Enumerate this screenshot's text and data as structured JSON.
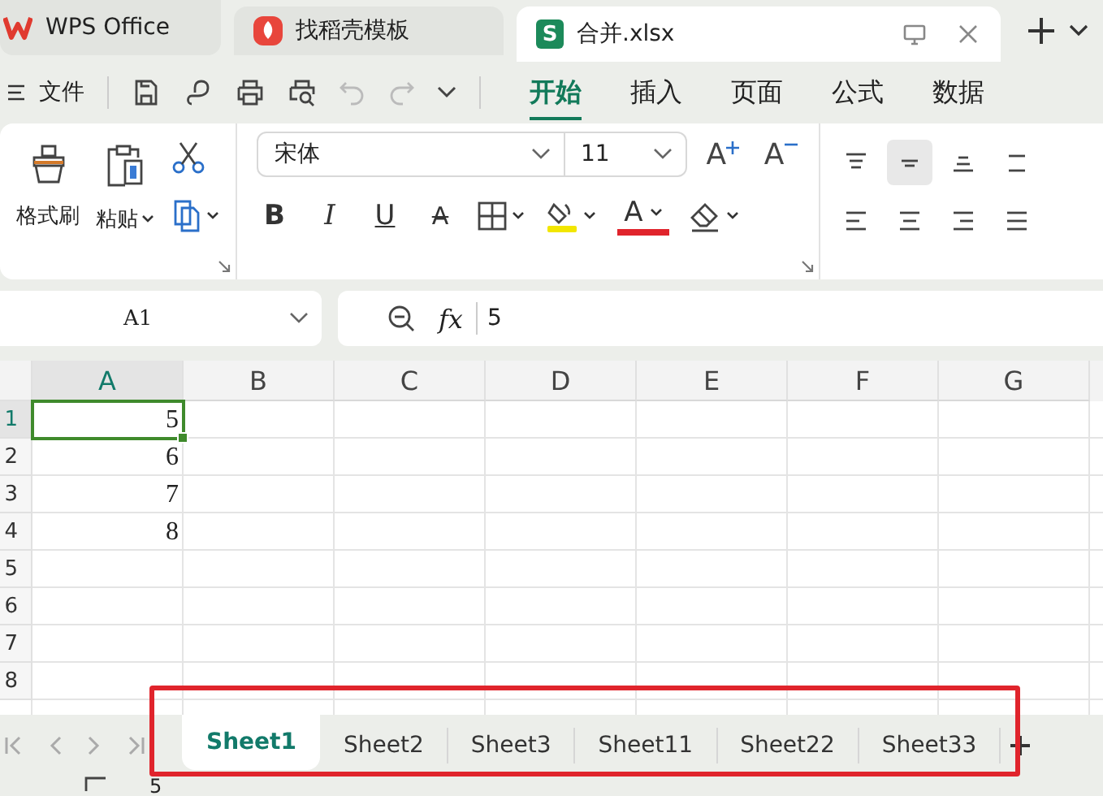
{
  "app_tabs": [
    {
      "label": "WPS Office",
      "kind": "wps",
      "selected": false
    },
    {
      "label": "找稻壳模板",
      "kind": "docer",
      "selected": false
    },
    {
      "label": "合并.xlsx",
      "kind": "sheet",
      "badge": "S",
      "selected": true
    }
  ],
  "menu": {
    "file": "文件",
    "tabs": [
      {
        "label": "开始",
        "selected": true
      },
      {
        "label": "插入",
        "selected": false
      },
      {
        "label": "页面",
        "selected": false
      },
      {
        "label": "公式",
        "selected": false
      },
      {
        "label": "数据",
        "selected": false
      }
    ]
  },
  "ribbon": {
    "format_painter": "格式刷",
    "paste": "粘贴",
    "font": "宋体",
    "size": "11",
    "grow": "A",
    "shrink": "A",
    "styles": [
      {
        "label": "B",
        "kind": "bold"
      },
      {
        "label": "I",
        "kind": "italic"
      },
      {
        "label": "U",
        "kind": "underline"
      },
      {
        "label": "A",
        "kind": "strike"
      }
    ],
    "font_color": "A",
    "align": [
      {
        "kind": "top",
        "selected": false
      },
      {
        "kind": "middle",
        "selected": true
      },
      {
        "kind": "bottom",
        "selected": false
      },
      {
        "kind": "indent",
        "selected": false
      },
      {
        "kind": "left",
        "selected": false
      },
      {
        "kind": "center",
        "selected": false
      },
      {
        "kind": "right",
        "selected": false
      },
      {
        "kind": "justify",
        "selected": false
      }
    ]
  },
  "formula_bar": {
    "cell": "A1",
    "fx": "fx",
    "value": "5"
  },
  "sheet": {
    "columns": [
      {
        "label": "A",
        "selected": true
      },
      {
        "label": "B",
        "selected": false
      },
      {
        "label": "C",
        "selected": false
      },
      {
        "label": "D",
        "selected": false
      },
      {
        "label": "E",
        "selected": false
      },
      {
        "label": "F",
        "selected": false
      },
      {
        "label": "G",
        "selected": false
      }
    ],
    "rows": [
      {
        "label": "1",
        "selected": true,
        "value": "5"
      },
      {
        "label": "2",
        "selected": false,
        "value": "6"
      },
      {
        "label": "3",
        "selected": false,
        "value": "7"
      },
      {
        "label": "4",
        "selected": false,
        "value": "8"
      },
      {
        "label": "5",
        "selected": false
      },
      {
        "label": "6",
        "selected": false
      },
      {
        "label": "7",
        "selected": false
      },
      {
        "label": "8",
        "selected": false
      }
    ]
  },
  "sheet_tabs": [
    {
      "label": "Sheet1",
      "selected": true
    },
    {
      "label": "Sheet2",
      "selected": false
    },
    {
      "label": "Sheet3",
      "selected": false
    },
    {
      "label": "Sheet11",
      "selected": false
    },
    {
      "label": "Sheet22",
      "selected": false
    },
    {
      "label": "Sheet33",
      "selected": false
    }
  ],
  "status_bar": {
    "value": "5"
  }
}
